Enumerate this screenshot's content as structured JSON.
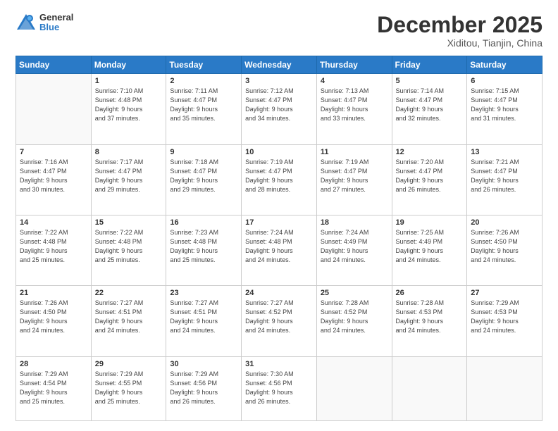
{
  "logo": {
    "general": "General",
    "blue": "Blue"
  },
  "header": {
    "month": "December 2025",
    "location": "Xiditou, Tianjin, China"
  },
  "days_of_week": [
    "Sunday",
    "Monday",
    "Tuesday",
    "Wednesday",
    "Thursday",
    "Friday",
    "Saturday"
  ],
  "weeks": [
    [
      {
        "day": "",
        "info": ""
      },
      {
        "day": "1",
        "info": "Sunrise: 7:10 AM\nSunset: 4:48 PM\nDaylight: 9 hours\nand 37 minutes."
      },
      {
        "day": "2",
        "info": "Sunrise: 7:11 AM\nSunset: 4:47 PM\nDaylight: 9 hours\nand 35 minutes."
      },
      {
        "day": "3",
        "info": "Sunrise: 7:12 AM\nSunset: 4:47 PM\nDaylight: 9 hours\nand 34 minutes."
      },
      {
        "day": "4",
        "info": "Sunrise: 7:13 AM\nSunset: 4:47 PM\nDaylight: 9 hours\nand 33 minutes."
      },
      {
        "day": "5",
        "info": "Sunrise: 7:14 AM\nSunset: 4:47 PM\nDaylight: 9 hours\nand 32 minutes."
      },
      {
        "day": "6",
        "info": "Sunrise: 7:15 AM\nSunset: 4:47 PM\nDaylight: 9 hours\nand 31 minutes."
      }
    ],
    [
      {
        "day": "7",
        "info": "Sunrise: 7:16 AM\nSunset: 4:47 PM\nDaylight: 9 hours\nand 30 minutes."
      },
      {
        "day": "8",
        "info": "Sunrise: 7:17 AM\nSunset: 4:47 PM\nDaylight: 9 hours\nand 29 minutes."
      },
      {
        "day": "9",
        "info": "Sunrise: 7:18 AM\nSunset: 4:47 PM\nDaylight: 9 hours\nand 29 minutes."
      },
      {
        "day": "10",
        "info": "Sunrise: 7:19 AM\nSunset: 4:47 PM\nDaylight: 9 hours\nand 28 minutes."
      },
      {
        "day": "11",
        "info": "Sunrise: 7:19 AM\nSunset: 4:47 PM\nDaylight: 9 hours\nand 27 minutes."
      },
      {
        "day": "12",
        "info": "Sunrise: 7:20 AM\nSunset: 4:47 PM\nDaylight: 9 hours\nand 26 minutes."
      },
      {
        "day": "13",
        "info": "Sunrise: 7:21 AM\nSunset: 4:47 PM\nDaylight: 9 hours\nand 26 minutes."
      }
    ],
    [
      {
        "day": "14",
        "info": "Sunrise: 7:22 AM\nSunset: 4:48 PM\nDaylight: 9 hours\nand 25 minutes."
      },
      {
        "day": "15",
        "info": "Sunrise: 7:22 AM\nSunset: 4:48 PM\nDaylight: 9 hours\nand 25 minutes."
      },
      {
        "day": "16",
        "info": "Sunrise: 7:23 AM\nSunset: 4:48 PM\nDaylight: 9 hours\nand 25 minutes."
      },
      {
        "day": "17",
        "info": "Sunrise: 7:24 AM\nSunset: 4:48 PM\nDaylight: 9 hours\nand 24 minutes."
      },
      {
        "day": "18",
        "info": "Sunrise: 7:24 AM\nSunset: 4:49 PM\nDaylight: 9 hours\nand 24 minutes."
      },
      {
        "day": "19",
        "info": "Sunrise: 7:25 AM\nSunset: 4:49 PM\nDaylight: 9 hours\nand 24 minutes."
      },
      {
        "day": "20",
        "info": "Sunrise: 7:26 AM\nSunset: 4:50 PM\nDaylight: 9 hours\nand 24 minutes."
      }
    ],
    [
      {
        "day": "21",
        "info": "Sunrise: 7:26 AM\nSunset: 4:50 PM\nDaylight: 9 hours\nand 24 minutes."
      },
      {
        "day": "22",
        "info": "Sunrise: 7:27 AM\nSunset: 4:51 PM\nDaylight: 9 hours\nand 24 minutes."
      },
      {
        "day": "23",
        "info": "Sunrise: 7:27 AM\nSunset: 4:51 PM\nDaylight: 9 hours\nand 24 minutes."
      },
      {
        "day": "24",
        "info": "Sunrise: 7:27 AM\nSunset: 4:52 PM\nDaylight: 9 hours\nand 24 minutes."
      },
      {
        "day": "25",
        "info": "Sunrise: 7:28 AM\nSunset: 4:52 PM\nDaylight: 9 hours\nand 24 minutes."
      },
      {
        "day": "26",
        "info": "Sunrise: 7:28 AM\nSunset: 4:53 PM\nDaylight: 9 hours\nand 24 minutes."
      },
      {
        "day": "27",
        "info": "Sunrise: 7:29 AM\nSunset: 4:53 PM\nDaylight: 9 hours\nand 24 minutes."
      }
    ],
    [
      {
        "day": "28",
        "info": "Sunrise: 7:29 AM\nSunset: 4:54 PM\nDaylight: 9 hours\nand 25 minutes."
      },
      {
        "day": "29",
        "info": "Sunrise: 7:29 AM\nSunset: 4:55 PM\nDaylight: 9 hours\nand 25 minutes."
      },
      {
        "day": "30",
        "info": "Sunrise: 7:29 AM\nSunset: 4:56 PM\nDaylight: 9 hours\nand 26 minutes."
      },
      {
        "day": "31",
        "info": "Sunrise: 7:30 AM\nSunset: 4:56 PM\nDaylight: 9 hours\nand 26 minutes."
      },
      {
        "day": "",
        "info": ""
      },
      {
        "day": "",
        "info": ""
      },
      {
        "day": "",
        "info": ""
      }
    ]
  ]
}
